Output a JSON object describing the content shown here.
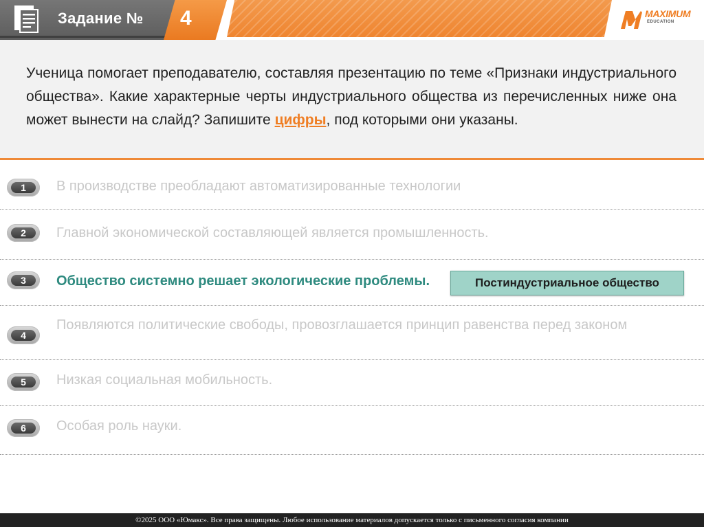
{
  "header": {
    "title": "Задание №",
    "number": "4",
    "logo_text": "MAXIMUM",
    "logo_subtext": "EDUCATION"
  },
  "question": {
    "text_before": "Ученица помогает преподавателю, составляя презентацию по теме «Признаки индустриального общества». Какие характерные черты индустриального общества из перечисленных ниже она может вынести на слайд? Запишите ",
    "highlight": "цифры",
    "text_after": ", под которыми они указаны."
  },
  "options": [
    {
      "num": "1",
      "text": "В производстве преобладают автоматизированные технологии"
    },
    {
      "num": "2",
      "text": "Главной экономической составляющей является промышленность."
    },
    {
      "num": "3",
      "text": "Общество системно решает экологические проблемы."
    },
    {
      "num": "4",
      "text": "Появляются политические свободы, провозглашается принцип равенства перед законом"
    },
    {
      "num": "5",
      "text": "Низкая социальная мобильность."
    },
    {
      "num": "6",
      "text": "Особая роль науки."
    }
  ],
  "tooltip": "Постиндустриальное общество",
  "footer": "©2025 ООО «Юмакс». Все права защищены. Любое использование материалов допускается только с  письменного согласия компании",
  "colors": {
    "accent": "#ef7e24",
    "active_option": "#2e8a7f",
    "tooltip_bg": "#9fd3c8"
  }
}
